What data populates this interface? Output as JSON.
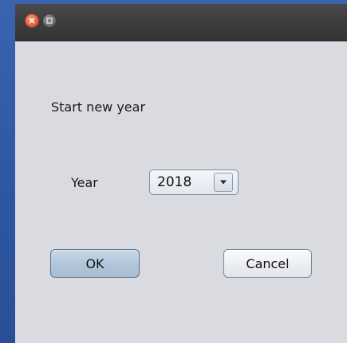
{
  "window": {
    "title": "",
    "controls": [
      {
        "name": "close",
        "icon": "close-icon",
        "color": "#e8663e"
      },
      {
        "name": "maximize",
        "icon": "maximize-icon",
        "color": "#6c6c6c"
      }
    ]
  },
  "dialog": {
    "heading": "Start new year",
    "year_label": "Year",
    "year_select": {
      "value": "2018",
      "icon": "chevron-down-icon"
    },
    "ok_label": "OK",
    "cancel_label": "Cancel"
  },
  "colors": {
    "desktop": "#2d56a2",
    "titlebar": "#3e3e3e",
    "dialog_bg": "#d9dbe1",
    "ok_button": "#b3c6da"
  }
}
